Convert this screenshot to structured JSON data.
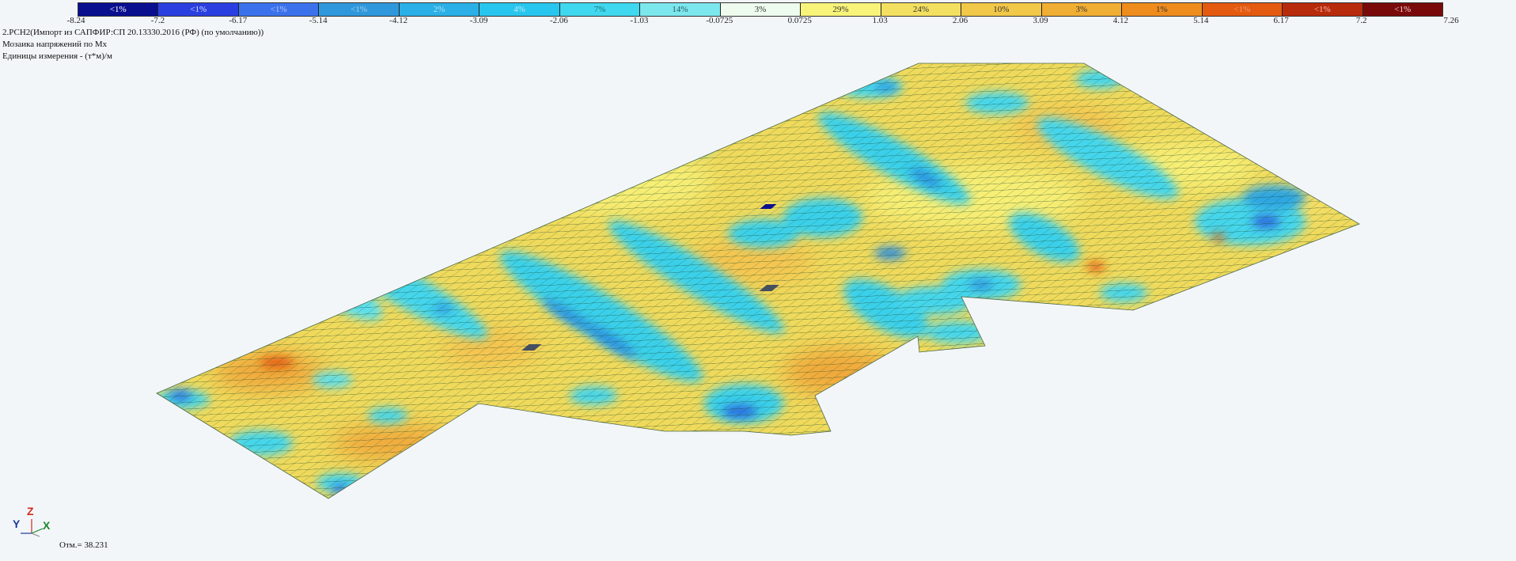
{
  "legend": {
    "cells": [
      {
        "label": "<1%",
        "color": "#0a0f8f",
        "text_color": "#ffffff"
      },
      {
        "label": "<1%",
        "color": "#2b3fe0",
        "text_color": "#d8dcff"
      },
      {
        "label": "<1%",
        "color": "#3b72ec",
        "text_color": "#b9c9f5"
      },
      {
        "label": "<1%",
        "color": "#2f98dc",
        "text_color": "#a8cfe8"
      },
      {
        "label": "2%",
        "color": "#2ab0e6",
        "text_color": "#b6e2f3"
      },
      {
        "label": "4%",
        "color": "#28c6ee",
        "text_color": "#c2ecf8"
      },
      {
        "label": "7%",
        "color": "#40d8ee",
        "text_color": "#1d6a78"
      },
      {
        "label": "14%",
        "color": "#7ce8ee",
        "text_color": "#2a5a60"
      },
      {
        "label": "3%",
        "color": "#eefcee",
        "text_color": "#333333"
      },
      {
        "label": "29%",
        "color": "#f8f47a",
        "text_color": "#333333"
      },
      {
        "label": "24%",
        "color": "#f4e060",
        "text_color": "#333333"
      },
      {
        "label": "10%",
        "color": "#f2c848",
        "text_color": "#333333"
      },
      {
        "label": "3%",
        "color": "#f0ae34",
        "text_color": "#333333"
      },
      {
        "label": "1%",
        "color": "#ee8c1e",
        "text_color": "#333333"
      },
      {
        "label": "<1%",
        "color": "#e45a10",
        "text_color": "#f0a070"
      },
      {
        "label": "<1%",
        "color": "#b82a0c",
        "text_color": "#f2c0b0"
      },
      {
        "label": "<1%",
        "color": "#7a0a0a",
        "text_color": "#f2d0d0"
      }
    ],
    "ticks": [
      "-8.24",
      "-7.2",
      "-6.17",
      "-5.14",
      "-4.12",
      "-3.09",
      "-2.06",
      "-1.03",
      "-0.0725",
      "0.0725",
      "1.03",
      "2.06",
      "3.09",
      "4.12",
      "5.14",
      "6.17",
      "7.2",
      "7.26"
    ]
  },
  "info": {
    "line1": "2.РСН2(Импорт из САПФИР:СП 20.13330.2016 (РФ) (по умолчанию))",
    "line2": "Мозаика напряжений по Мх",
    "line3": "Единицы измерения - (т*м)/м"
  },
  "axes": {
    "z": "Z",
    "y": "Y",
    "x": "X"
  },
  "elevation": "Отм.= 38.231",
  "colors": {
    "background": "#f3f6f9",
    "mesh_line": "#1a4a2a",
    "base_fill": "#f0da5c"
  }
}
